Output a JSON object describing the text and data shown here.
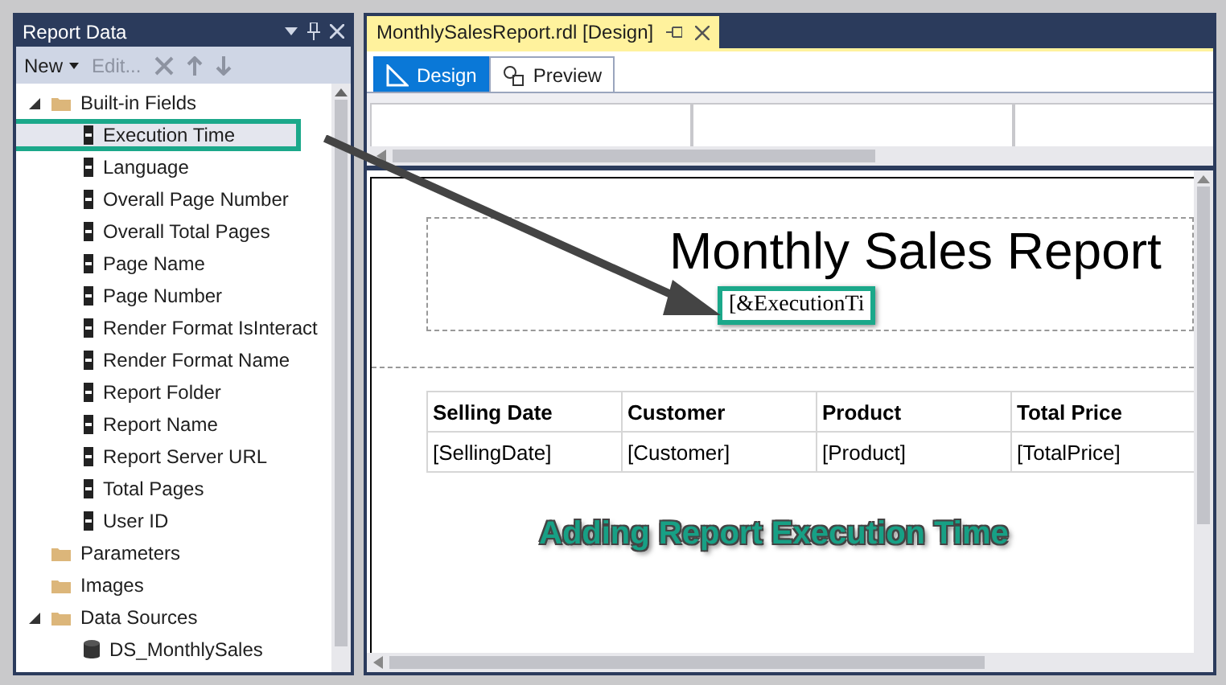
{
  "report_data": {
    "title": "Report Data",
    "toolbar": [
      {
        "label": "New",
        "kind": "dropdown",
        "disabled": false
      },
      {
        "label": "Edit...",
        "kind": "button",
        "disabled": true
      },
      {
        "kind": "delete",
        "disabled": true
      },
      {
        "kind": "up",
        "disabled": true
      },
      {
        "kind": "down",
        "disabled": true
      }
    ],
    "tree": [
      {
        "label": "Built-in Fields",
        "kind": "folder",
        "expanded": true,
        "children": [
          {
            "label": "Execution Time",
            "kind": "field",
            "highlighted": true
          },
          {
            "label": "Language",
            "kind": "field",
            "highlighted": false
          },
          {
            "label": "Overall Page Number",
            "kind": "field",
            "highlighted": false
          },
          {
            "label": "Overall Total Pages",
            "kind": "field",
            "highlighted": false
          },
          {
            "label": "Page Name",
            "kind": "field",
            "highlighted": false
          },
          {
            "label": "Page Number",
            "kind": "field",
            "highlighted": false
          },
          {
            "label": "Render Format IsInteract",
            "kind": "field",
            "highlighted": false
          },
          {
            "label": "Render Format Name",
            "kind": "field",
            "highlighted": false
          },
          {
            "label": "Report Folder",
            "kind": "field",
            "highlighted": false
          },
          {
            "label": "Report Name",
            "kind": "field",
            "highlighted": false
          },
          {
            "label": "Report Server URL",
            "kind": "field",
            "highlighted": false
          },
          {
            "label": "Total Pages",
            "kind": "field",
            "highlighted": false
          },
          {
            "label": "User ID",
            "kind": "field",
            "highlighted": false
          }
        ]
      },
      {
        "label": "Parameters",
        "kind": "folder"
      },
      {
        "label": "Images",
        "kind": "folder"
      },
      {
        "label": "Data Sources",
        "kind": "folder",
        "expanded": true,
        "children": [
          {
            "label": "DS_MonthlySales",
            "kind": "datasource"
          }
        ]
      }
    ]
  },
  "document": {
    "tab_title": "MonthlySalesReport.rdl [Design]",
    "view_tabs": [
      {
        "label": "Design",
        "kind": "design",
        "selected": true
      },
      {
        "label": "Preview",
        "kind": "preview",
        "selected": false
      }
    ],
    "report": {
      "title": "Monthly Sales Report",
      "expression": "[&ExecutionTi",
      "table": {
        "columns": [
          "Selling Date",
          "Customer",
          "Product",
          "Total Price"
        ],
        "rows": [
          [
            "[SellingDate]",
            "[Customer]",
            "[Product]",
            "[TotalPrice]"
          ]
        ]
      }
    },
    "annotation": "Adding Report Execution Time"
  }
}
